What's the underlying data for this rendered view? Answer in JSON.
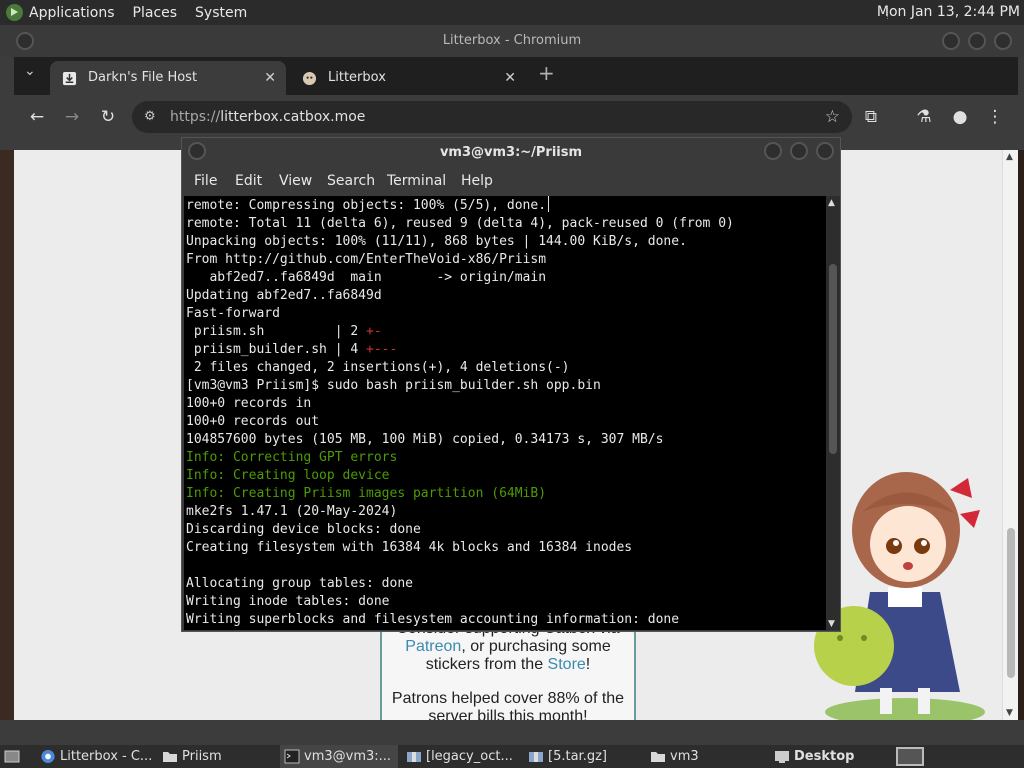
{
  "top_panel": {
    "menus": [
      "Applications",
      "Places",
      "System"
    ],
    "clock": "Mon Jan 13, 2:44 PM"
  },
  "browser": {
    "window_title": "Litterbox - Chromium",
    "tabs": [
      {
        "title": "Darkn's File Host",
        "icon": "download-icon"
      },
      {
        "title": "Litterbox",
        "icon": "cat-favicon-icon"
      }
    ],
    "url_prefix": "https://",
    "url_host": "litterbox.catbox.moe"
  },
  "page": {
    "support_line1": "Consider supporting Catbox via",
    "support_link1": "Patreon",
    "support_line2": ", or purchasing some stickers from the ",
    "support_link2": "Store",
    "support_line3": "!",
    "patrons_text": "Patrons helped cover 88% of the server bills this month!"
  },
  "terminal": {
    "title": "vm3@vm3:~/Priism",
    "menu": [
      "File",
      "Edit",
      "View",
      "Search",
      "Terminal",
      "Help"
    ],
    "lines": [
      {
        "text": "remote: Compressing objects: 100% (5/5), done.",
        "color": "normal"
      },
      {
        "text": "remote: Total 11 (delta 6), reused 9 (delta 4), pack-reused 0 (from 0)",
        "color": "normal"
      },
      {
        "text": "Unpacking objects: 100% (11/11), 868 bytes | 144.00 KiB/s, done.",
        "color": "normal"
      },
      {
        "text": "From http://github.com/EnterTheVoid-x86/Priism",
        "color": "normal"
      },
      {
        "text": "   abf2ed7..fa6849d  main       -> origin/main",
        "color": "normal"
      },
      {
        "text": "Updating abf2ed7..fa6849d",
        "color": "normal"
      },
      {
        "text": "Fast-forward",
        "color": "normal"
      },
      {
        "text": " priism.sh         | 2 ",
        "suffix": "+-",
        "color": "diff"
      },
      {
        "text": " priism_builder.sh | 4 ",
        "suffix": "+---",
        "color": "diff"
      },
      {
        "text": " 2 files changed, 2 insertions(+), 4 deletions(-)",
        "color": "normal"
      },
      {
        "text": "[vm3@vm3 Priism]$ sudo bash priism_builder.sh opp.bin",
        "color": "normal"
      },
      {
        "text": "100+0 records in",
        "color": "normal"
      },
      {
        "text": "100+0 records out",
        "color": "normal"
      },
      {
        "text": "104857600 bytes (105 MB, 100 MiB) copied, 0.34173 s, 307 MB/s",
        "color": "normal"
      },
      {
        "text": "Info: Correcting GPT errors",
        "color": "green"
      },
      {
        "text": "Info: Creating loop device",
        "color": "green"
      },
      {
        "text": "Info: Creating Priism images partition (64MiB)",
        "color": "green"
      },
      {
        "text": "mke2fs 1.47.1 (20-May-2024)",
        "color": "normal"
      },
      {
        "text": "Discarding device blocks: done",
        "color": "normal"
      },
      {
        "text": "Creating filesystem with 16384 4k blocks and 16384 inodes",
        "color": "normal"
      },
      {
        "text": "",
        "color": "normal"
      },
      {
        "text": "Allocating group tables: done",
        "color": "normal"
      },
      {
        "text": "Writing inode tables: done",
        "color": "normal"
      },
      {
        "text": "Writing superblocks and filesystem accounting information: done",
        "color": "normal"
      }
    ]
  },
  "taskbar": {
    "items": [
      {
        "label": "Litterbox - C...",
        "icon": "chromium-icon"
      },
      {
        "label": "Priism",
        "icon": "folder-icon"
      },
      {
        "label": "vm3@vm3:...",
        "icon": "terminal-icon"
      },
      {
        "label": "[legacy_oct...",
        "icon": "archive-icon"
      },
      {
        "label": "[5.tar.gz]",
        "icon": "archive-icon"
      },
      {
        "label": "vm3",
        "icon": "folder-icon"
      }
    ],
    "desktop_label": "Desktop"
  },
  "colors": {
    "terminal_green": "#4e9a06",
    "terminal_red": "#cc3333",
    "link_blue": "#3b8ab0"
  }
}
